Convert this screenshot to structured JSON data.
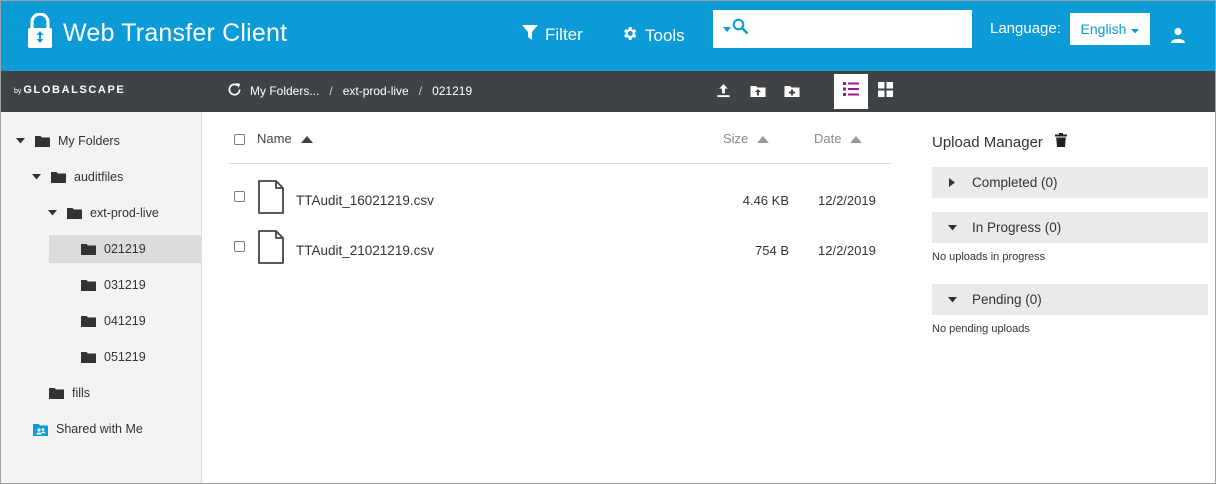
{
  "header": {
    "title": "Web Transfer Client",
    "filter_label": "Filter",
    "tools_label": "Tools",
    "search_placeholder": "",
    "search_value": "",
    "language_label": "Language:",
    "language_value": "English"
  },
  "subbar": {
    "by_text": "by",
    "brand_text": "GLOBALSCAPE",
    "breadcrumb": [
      "My Folders...",
      "ext-prod-live",
      "021219"
    ],
    "separator": "/"
  },
  "sidebar": {
    "items": [
      {
        "label": "My Folders"
      },
      {
        "label": "auditfiles"
      },
      {
        "label": "ext-prod-live"
      },
      {
        "label": "021219"
      },
      {
        "label": "031219"
      },
      {
        "label": "041219"
      },
      {
        "label": "051219"
      },
      {
        "label": "fills"
      },
      {
        "label": "Shared with Me"
      }
    ]
  },
  "filelist": {
    "columns": {
      "name": "Name",
      "size": "Size",
      "date": "Date"
    },
    "rows": [
      {
        "name": "TTAudit_16021219.csv",
        "size": "4.46 KB",
        "date": "12/2/2019"
      },
      {
        "name": "TTAudit_21021219.csv",
        "size": "754 B",
        "date": "12/2/2019"
      }
    ]
  },
  "upload_manager": {
    "title": "Upload Manager",
    "panels": [
      {
        "label": "Completed (0)",
        "expanded": false,
        "empty_text": ""
      },
      {
        "label": "In Progress (0)",
        "expanded": true,
        "empty_text": "No uploads in progress"
      },
      {
        "label": "Pending (0)",
        "expanded": true,
        "empty_text": "No pending uploads"
      }
    ]
  },
  "colors": {
    "header_blue": "#0b9bd6",
    "subbar_dark": "#3d4347",
    "active_view_accent": "#a3178a",
    "sidebar_bg": "#f3f3f3",
    "selected_row": "#dcdcdc"
  },
  "icons": {
    "brand": "padlock-icon",
    "filter": "funnel-icon",
    "tools": "gear-icon",
    "search": "search-icon",
    "user": "user-icon",
    "refresh": "refresh-icon",
    "upload": "upload-icon",
    "upload_folder": "folder-upload-icon",
    "new_folder": "folder-add-icon",
    "list_view": "list-view-icon",
    "grid_view": "grid-view-icon",
    "trash": "trash-icon"
  }
}
